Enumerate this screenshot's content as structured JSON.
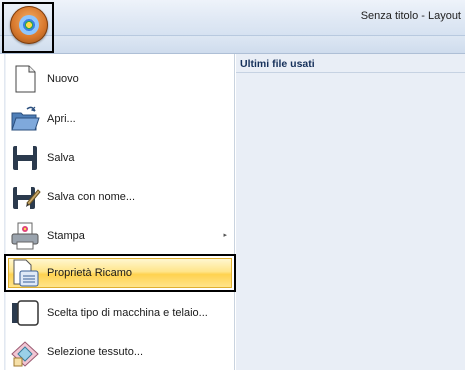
{
  "window": {
    "title": "Senza titolo - Layout"
  },
  "menu": {
    "items": [
      {
        "label": "Nuovo",
        "icon": "new-document-icon"
      },
      {
        "label": "Apri...",
        "icon": "open-folder-icon"
      },
      {
        "label": "Salva",
        "icon": "save-disk-icon"
      },
      {
        "label": "Salva con nome...",
        "icon": "save-as-icon"
      },
      {
        "label": "Stampa",
        "icon": "print-icon",
        "has_submenu": true
      },
      {
        "label": "Proprietà Ricamo",
        "icon": "embroidery-properties-icon",
        "highlighted": true
      },
      {
        "label": "Scelta tipo di macchina e telaio...",
        "icon": "machine-hoop-icon"
      },
      {
        "label": "Selezione tessuto...",
        "icon": "fabric-select-icon"
      }
    ],
    "submenu_arrow": "▸"
  },
  "recent": {
    "header": "Ultimi file usati"
  },
  "colors": {
    "highlight": "#ffe58a",
    "panel": "#e9eef6",
    "accent": "#15305a"
  }
}
